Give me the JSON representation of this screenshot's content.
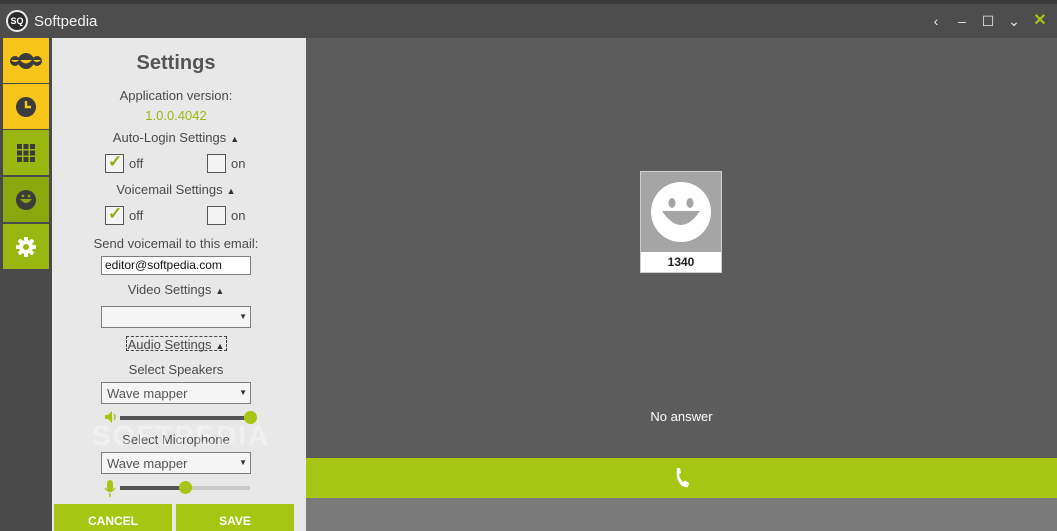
{
  "window": {
    "title": "Softpedia",
    "logo_text": "SQ",
    "controls": {
      "back": "‹",
      "minimize": "–",
      "maximize": "☐",
      "menu": "⌄",
      "close": "✕"
    }
  },
  "rail": {
    "items": [
      {
        "name": "contacts",
        "icon": "smileys-icon"
      },
      {
        "name": "history",
        "icon": "clock-icon"
      },
      {
        "name": "dialpad",
        "icon": "grid-icon"
      },
      {
        "name": "profile",
        "icon": "smiley-icon"
      },
      {
        "name": "settings",
        "icon": "gear-icon"
      }
    ]
  },
  "settings": {
    "title": "Settings",
    "app_version_label": "Application version:",
    "app_version": "1.0.0.4042",
    "auto_login": {
      "label": "Auto-Login Settings",
      "off": "off",
      "on": "on",
      "selected": "off"
    },
    "voicemail": {
      "label": "Voicemail Settings",
      "off": "off",
      "on": "on",
      "selected": "off"
    },
    "voicemail_email_label": "Send voicemail to this email:",
    "voicemail_email": "editor@softpedia.com",
    "video_label": "Video Settings",
    "video_device": "",
    "audio_label": "Audio Settings",
    "speakers_label": "Select Speakers",
    "speakers_device": "Wave mapper",
    "speaker_volume": 1.0,
    "microphone_label": "Select Microphone",
    "microphone_device": "Wave mapper",
    "microphone_volume": 0.5,
    "cancel": "CANCEL",
    "save": "SAVE"
  },
  "call": {
    "contact_number": "1340",
    "status": "No answer"
  },
  "watermark": "SOFTPEDIA",
  "colors": {
    "accent": "#a6c613",
    "yellow": "#f7c519"
  }
}
